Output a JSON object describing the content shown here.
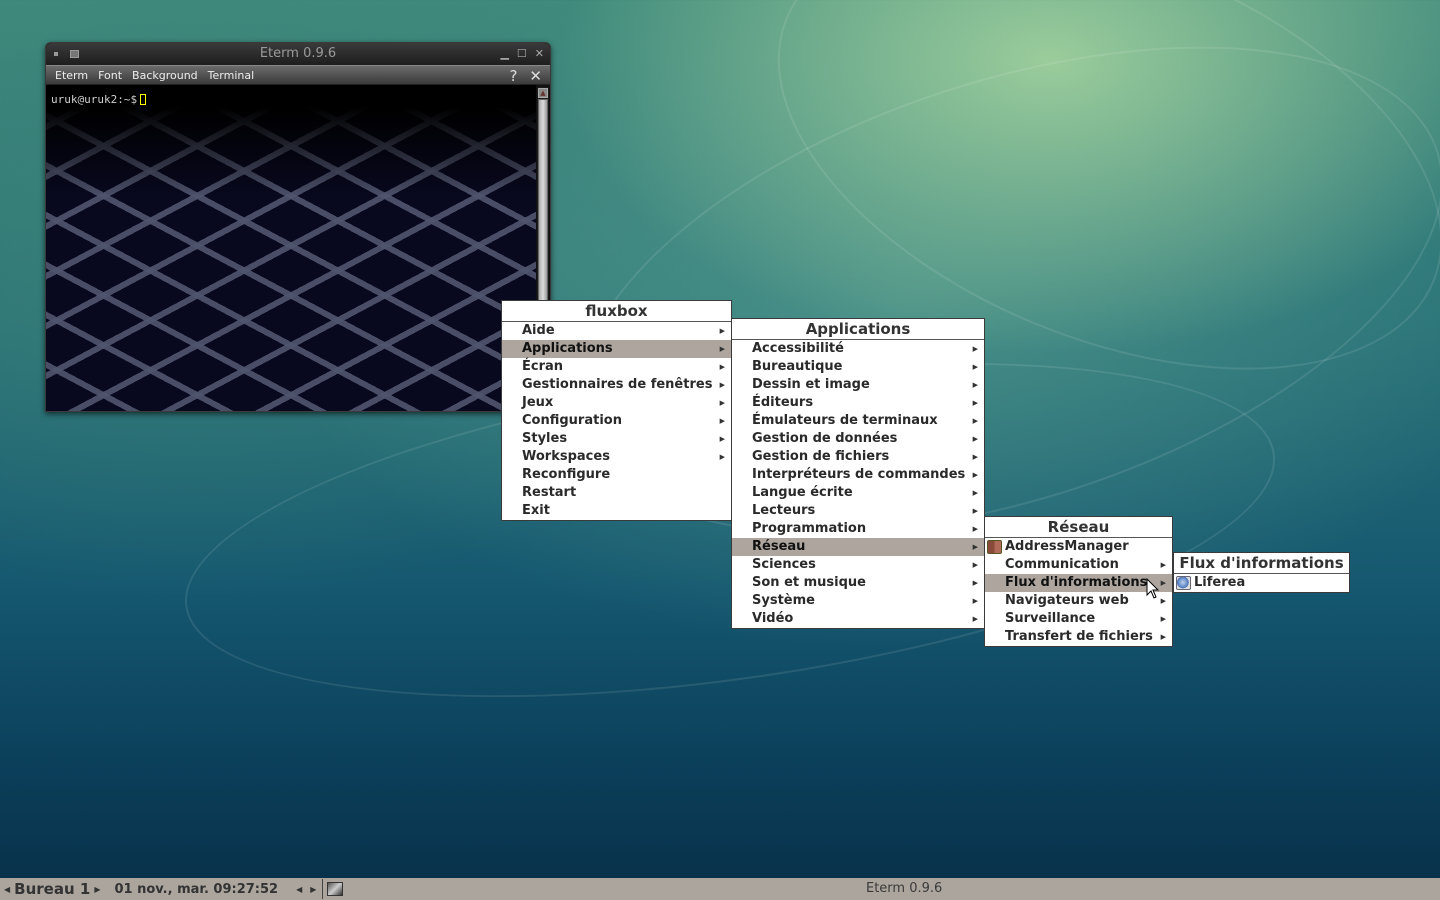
{
  "desktop": {
    "wallpaper": "green-teal swirl",
    "colors": {
      "menu_highlight": "#aea69e",
      "taskbar_bg": "#aca59d",
      "cursor_color": "#ffff00"
    }
  },
  "eterm": {
    "title": "Eterm 0.9.6",
    "menubar": [
      "Eterm",
      "Font",
      "Background",
      "Terminal"
    ],
    "help_label": "?",
    "close_label": "✕",
    "prompt": "uruk@uruk2:~$",
    "title_buttons": {
      "minimize": "▁",
      "maximize": "☐",
      "close": "✕"
    }
  },
  "menus": {
    "root": {
      "title": "fluxbox",
      "items": [
        {
          "label": "Aide",
          "submenu": true
        },
        {
          "label": "Applications",
          "submenu": true,
          "active": true
        },
        {
          "label": "Écran",
          "submenu": true
        },
        {
          "label": "Gestionnaires de fenêtres",
          "submenu": true
        },
        {
          "label": "Jeux",
          "submenu": true
        },
        {
          "label": "Configuration",
          "submenu": true
        },
        {
          "label": "Styles",
          "submenu": true
        },
        {
          "label": "Workspaces",
          "submenu": true
        },
        {
          "label": "Reconfigure",
          "submenu": false
        },
        {
          "label": "Restart",
          "submenu": false
        },
        {
          "label": "Exit",
          "submenu": false
        }
      ]
    },
    "applications": {
      "title": "Applications",
      "items": [
        {
          "label": "Accessibilité",
          "submenu": true
        },
        {
          "label": "Bureautique",
          "submenu": true
        },
        {
          "label": "Dessin et image",
          "submenu": true
        },
        {
          "label": "Éditeurs",
          "submenu": true
        },
        {
          "label": "Émulateurs de terminaux",
          "submenu": true
        },
        {
          "label": "Gestion de données",
          "submenu": true
        },
        {
          "label": "Gestion de fichiers",
          "submenu": true
        },
        {
          "label": "Interpréteurs de commandes",
          "submenu": true
        },
        {
          "label": "Langue écrite",
          "submenu": true
        },
        {
          "label": "Lecteurs",
          "submenu": true
        },
        {
          "label": "Programmation",
          "submenu": true
        },
        {
          "label": "Réseau",
          "submenu": true,
          "active": true
        },
        {
          "label": "Sciences",
          "submenu": true
        },
        {
          "label": "Son et musique",
          "submenu": true
        },
        {
          "label": "Système",
          "submenu": true
        },
        {
          "label": "Vidéo",
          "submenu": true
        }
      ]
    },
    "reseau": {
      "title": "Réseau",
      "items": [
        {
          "label": "AddressManager",
          "submenu": false,
          "icon": "address-book-icon"
        },
        {
          "label": "Communication",
          "submenu": true
        },
        {
          "label": "Flux d'informations",
          "submenu": true,
          "active": true
        },
        {
          "label": "Navigateurs web",
          "submenu": true
        },
        {
          "label": "Surveillance",
          "submenu": true
        },
        {
          "label": "Transfert de fichiers",
          "submenu": true
        }
      ]
    },
    "flux": {
      "title": "Flux d'informations",
      "items": [
        {
          "label": "Liferea",
          "submenu": false,
          "icon": "liferea-icon"
        }
      ]
    }
  },
  "taskbar": {
    "workspace": "Bureau 1",
    "clock": "01 nov., mar. 09:27:52",
    "task": "Eterm 0.9.6",
    "prev_arrow": "◀",
    "next_arrow": "▶"
  }
}
